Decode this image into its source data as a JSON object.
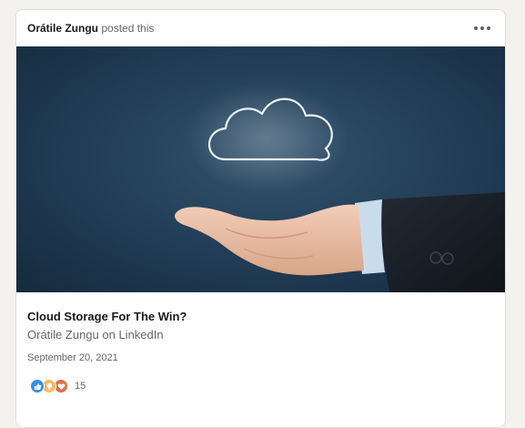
{
  "post": {
    "author": "Orátile Zungu",
    "action": "posted this"
  },
  "menu": {
    "icon": "more-horizontal-icon"
  },
  "hero_image": {
    "subject": "hand-with-cloud-icon",
    "background_color": "#213c55"
  },
  "article": {
    "title": "Cloud Storage For The Win?",
    "source": "Orátile Zungu on LinkedIn",
    "date": "September 20, 2021"
  },
  "reactions": {
    "icons": [
      "like-icon",
      "insightful-icon",
      "love-icon"
    ],
    "count": "15",
    "colors": {
      "like": "#378fe9",
      "insightful": "#f5bb5c",
      "love": "#df704d"
    }
  }
}
